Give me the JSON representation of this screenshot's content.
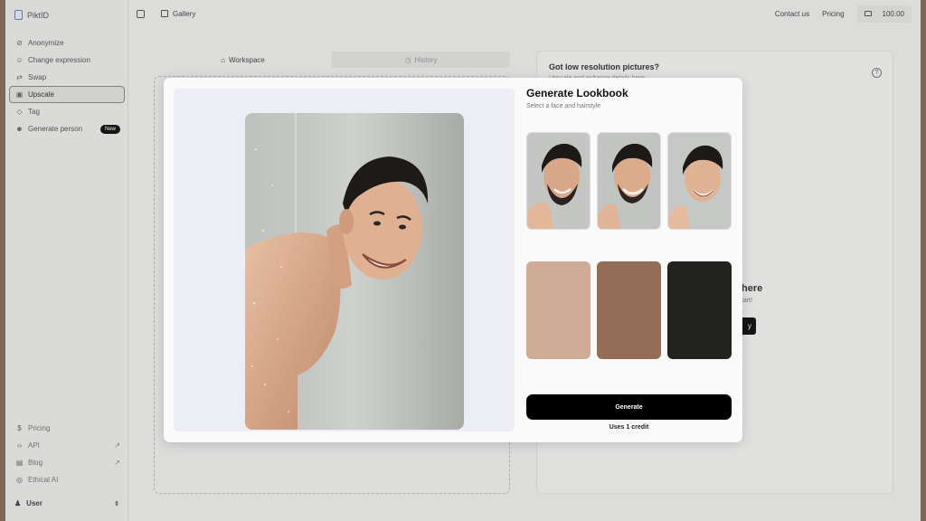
{
  "app": {
    "brand": "PiktID"
  },
  "sidebar": {
    "items": [
      {
        "label": "Anonymize",
        "icon": "anonymize-icon"
      },
      {
        "label": "Change expression",
        "icon": "face-icon"
      },
      {
        "label": "Swap",
        "icon": "swap-icon"
      },
      {
        "label": "Upscale",
        "icon": "upscale-icon",
        "active": true
      },
      {
        "label": "Tag",
        "icon": "tag-icon"
      },
      {
        "label": "Generate person",
        "icon": "users-icon",
        "badge": "New"
      }
    ],
    "bottom_items": [
      {
        "label": "Pricing",
        "icon": "dollar-icon"
      },
      {
        "label": "API",
        "icon": "code-icon",
        "arrow": "↗"
      },
      {
        "label": "Blog",
        "icon": "book-icon",
        "arrow": "↗"
      },
      {
        "label": "Ethical AI",
        "icon": "globe-icon"
      }
    ],
    "user_label": "User"
  },
  "topbar": {
    "gallery_label": "Gallery",
    "contact_label": "Contact us",
    "pricing_label": "Pricing",
    "credits_value": "100.00"
  },
  "workspace": {
    "tabs": [
      {
        "label": "Workspace",
        "icon": "home-icon",
        "active": true
      },
      {
        "label": "History",
        "icon": "history-icon",
        "active": false
      }
    ]
  },
  "right_panel": {
    "title": "Got low resolution pictures?",
    "subtitle": "Upscale and enhance details here",
    "help": "?",
    "drop_title": "here",
    "drop_sub": "tart!",
    "button_label": "y"
  },
  "modal": {
    "title": "Generate Lookbook",
    "subtitle": "Select a face and hairstyle",
    "swatches": [
      "#cfac98",
      "#946d58",
      "#22221f"
    ],
    "generate_label": "Generate",
    "credit_note": "Uses 1 credit"
  }
}
